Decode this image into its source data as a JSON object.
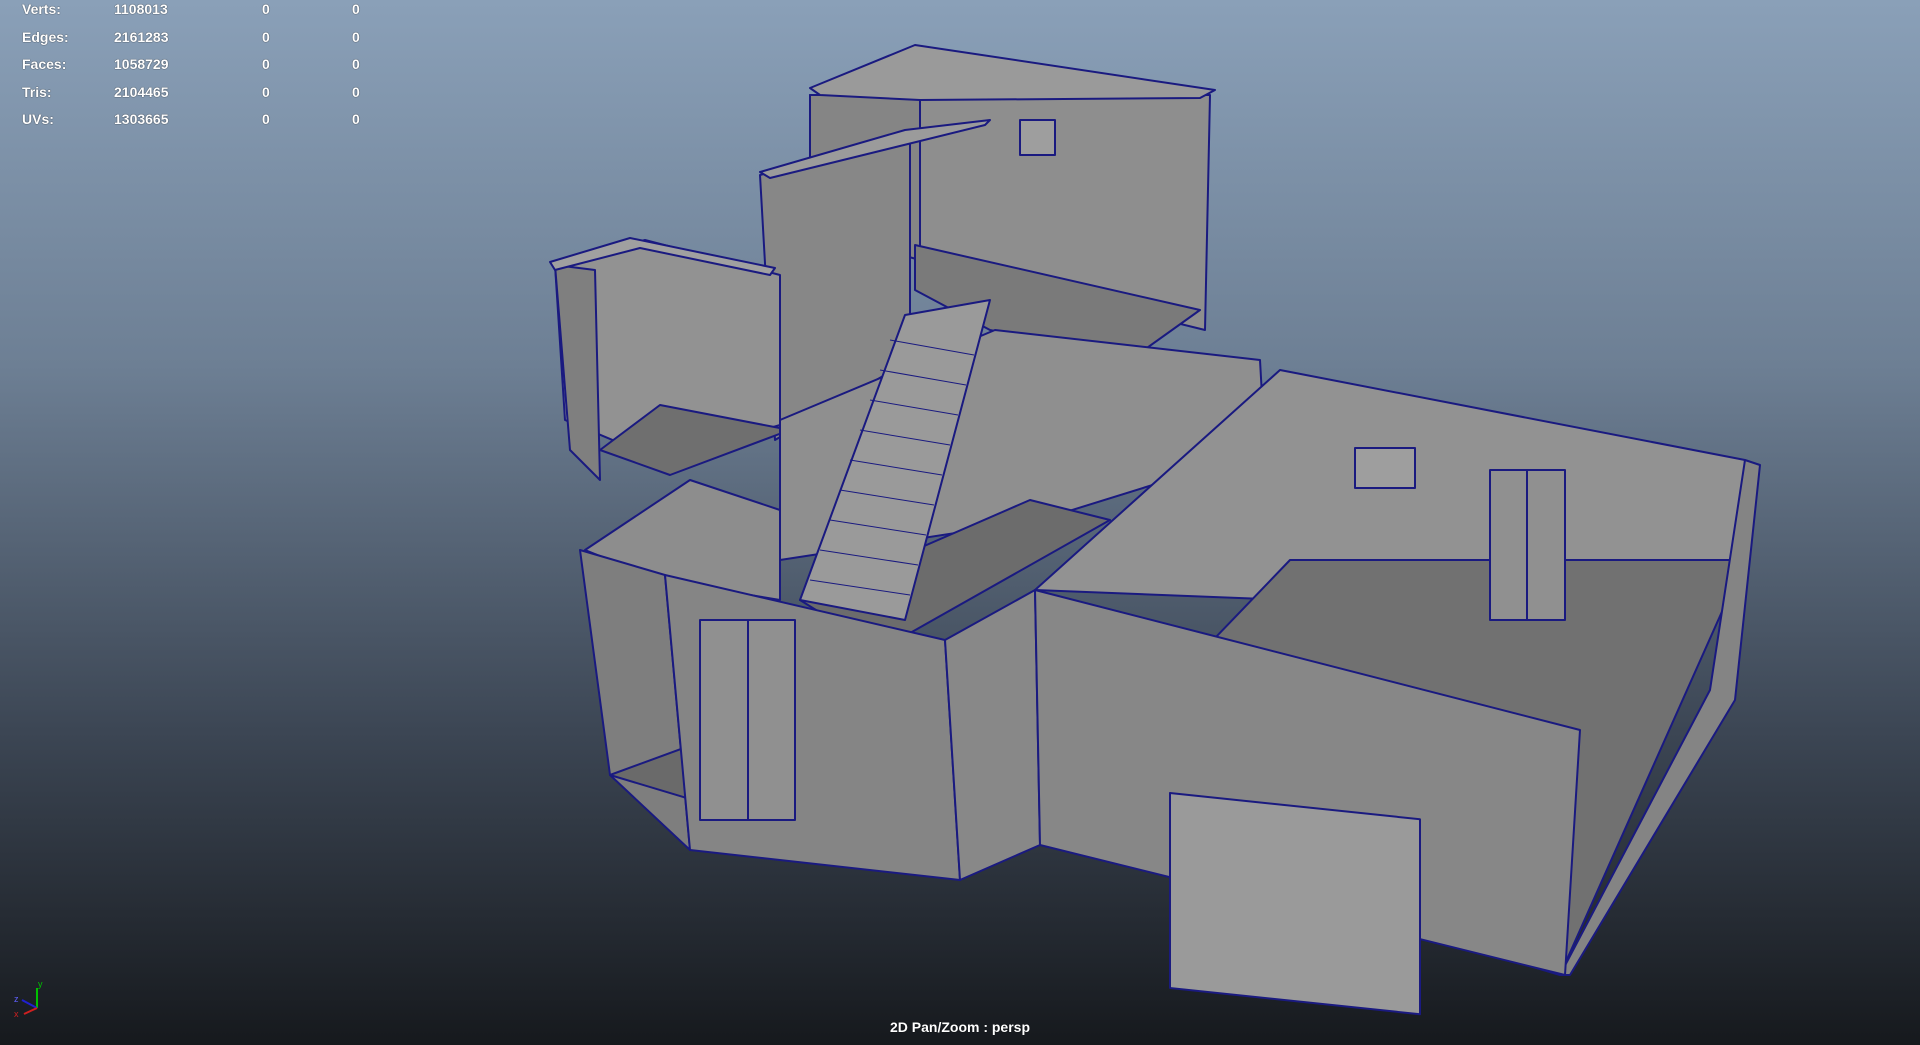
{
  "hud": {
    "rows": [
      {
        "label": "Verts:",
        "values": [
          "1108013",
          "0",
          "0"
        ]
      },
      {
        "label": "Edges:",
        "values": [
          "2161283",
          "0",
          "0"
        ]
      },
      {
        "label": "Faces:",
        "values": [
          "1058729",
          "0",
          "0"
        ]
      },
      {
        "label": "Tris:",
        "values": [
          "2104465",
          "0",
          "0"
        ]
      },
      {
        "label": "UVs:",
        "values": [
          "1303665",
          "0",
          "0"
        ]
      }
    ]
  },
  "viewport": {
    "camera_label": "2D Pan/Zoom : persp",
    "axis_labels": {
      "x": "x",
      "y": "y",
      "z": "z"
    }
  },
  "colors": {
    "wireframe": "#1a1a80",
    "surface": "#8c8c8c",
    "background_top": "#8aa0b8",
    "background_bottom": "#16191d"
  }
}
